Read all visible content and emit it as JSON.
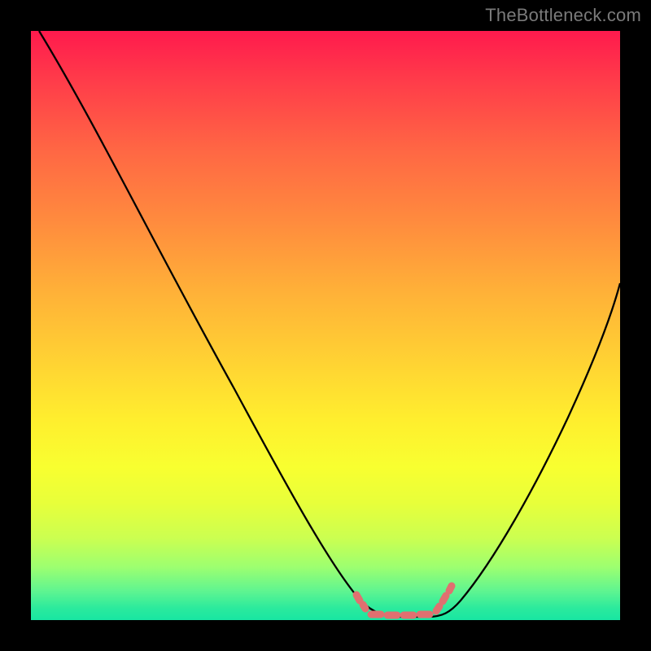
{
  "watermark": "TheBottleneck.com",
  "colors": {
    "frame": "#000000",
    "curve": "#000000",
    "marker": "#e07070",
    "gradient_top": "#ff1a4d",
    "gradient_bottom": "#18e6a2"
  },
  "chart_data": {
    "type": "line",
    "title": "",
    "xlabel": "",
    "ylabel": "",
    "xlim": [
      0,
      100
    ],
    "ylim": [
      0,
      100
    ],
    "grid": false,
    "x": [
      0,
      10,
      20,
      30,
      40,
      50,
      55,
      57,
      60,
      65,
      68,
      70,
      75,
      80,
      90,
      100
    ],
    "values": [
      100,
      82,
      64,
      46,
      28,
      12,
      5,
      2,
      0,
      0,
      2,
      4,
      10,
      20,
      40,
      62
    ],
    "annotations": [
      {
        "kind": "flat-bottom-marker",
        "x_start": 55,
        "x_end": 68,
        "y": 1
      }
    ]
  }
}
